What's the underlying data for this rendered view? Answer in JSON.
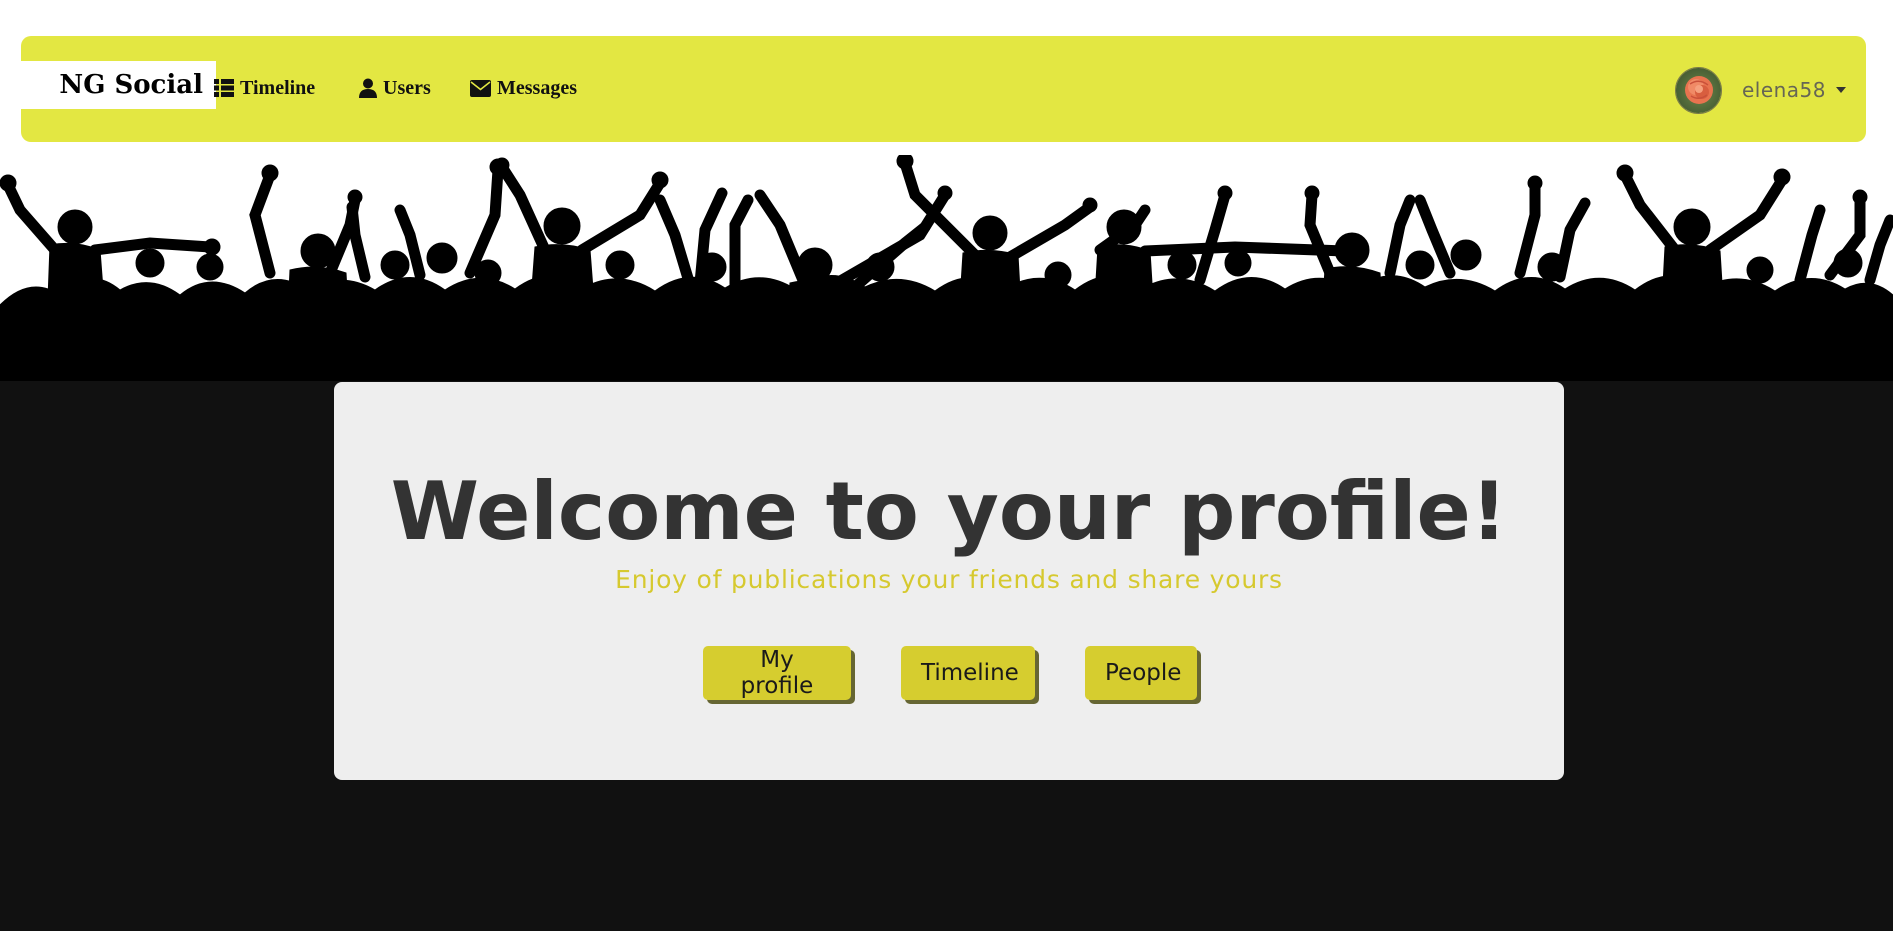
{
  "navbar": {
    "brand": "NG Social",
    "links": [
      {
        "label": "Timeline",
        "icon": "list-icon"
      },
      {
        "label": "Users",
        "icon": "user-icon"
      },
      {
        "label": "Messages",
        "icon": "envelope-icon"
      }
    ],
    "user": {
      "username": "elena58",
      "avatar": "rose-avatar"
    }
  },
  "hero": {
    "banner": "crowd-silhouette"
  },
  "jumbotron": {
    "title": "Welcome to your profile!",
    "subtitle": "Enjoy of publications your friends and share yours",
    "buttons": [
      {
        "label": "My profile"
      },
      {
        "label": "Timeline"
      },
      {
        "label": "People"
      }
    ]
  },
  "colors": {
    "navbar": "#e3e742",
    "accent": "#d6cd2f",
    "background": "#111111",
    "panel": "#eeeeee"
  }
}
